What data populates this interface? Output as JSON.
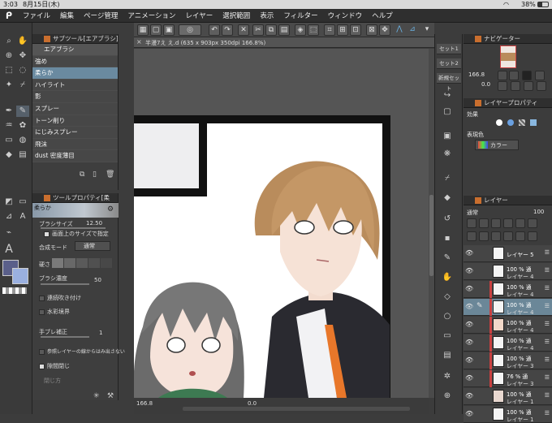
{
  "status_bar": {
    "time": "3:03",
    "date": "8月15日(木)",
    "battery": "38%"
  },
  "menu": {
    "items": [
      "ファイル",
      "編集",
      "ページ管理",
      "アニメーション",
      "レイヤー",
      "選択範囲",
      "表示",
      "フィルター",
      "ウィンドウ",
      "ヘルプ"
    ]
  },
  "document": {
    "tab_title": "半漫7え え.d (635 x 903px 350dpi 166.8%)"
  },
  "subtool": {
    "header": "サブツール[エアブラシ]",
    "group": "エアブラシ",
    "items": [
      "強め",
      "柔らか",
      "ハイライト",
      "影",
      "スプレー",
      "トーン削り",
      "にじみスプレー",
      "飛沫",
      "dust 密度薄目"
    ],
    "selected_index": 1
  },
  "tool_property": {
    "header": "ツールプロパティ[柔",
    "preview_label": "柔らか",
    "brush_size_label": "ブラシサイズ",
    "brush_size_value": "12.50",
    "canvas_size_label": "画面上のサイズで指定",
    "blend_label": "合成モード",
    "blend_value": "通常",
    "hardness_label": "硬さ",
    "density_label": "ブラシ濃度",
    "density_value": "50",
    "continuous_label": "連続吹き付け",
    "watercolor_label": "水彩境界",
    "stabilize_label": "手ブレ補正",
    "stabilize_value": "1",
    "reference_label": "参照レイヤーの線からはみ出さない",
    "gap_label": "隙間閉じ",
    "gap_method_label": "閉じ方"
  },
  "canvas_footer": {
    "zoom": "166.8",
    "zero": "0.0"
  },
  "right_strip": {
    "tabs": [
      "セット1",
      "セット2",
      "新規セット"
    ]
  },
  "navigator": {
    "header": "ナビゲーター",
    "zoom": "166.8",
    "rotation": "0.0"
  },
  "layer_property": {
    "header": "レイヤープロパティ",
    "effect_label": "効果",
    "expression_label": "表現色",
    "expression_value": "カラー"
  },
  "layers": {
    "header": "レイヤー",
    "blend": "通常",
    "opacity": "100",
    "rows": [
      {
        "line1": "レイヤー 5",
        "line2": ""
      },
      {
        "line1": "100 % 通",
        "line2": "レイヤー 4"
      },
      {
        "line1": "100 % 通",
        "line2": "レイヤー 4"
      },
      {
        "line1": "100 % 通",
        "line2": "レイヤー 4"
      },
      {
        "line1": "100 % 通",
        "line2": "レイヤー 4"
      },
      {
        "line1": "100 % 通",
        "line2": "レイヤー 4"
      },
      {
        "line1": "100 % 通",
        "line2": "レイヤー 3"
      },
      {
        "line1": "76 % 通",
        "line2": "レイヤー 3"
      },
      {
        "line1": "100 % 通",
        "line2": "レイヤー 1"
      },
      {
        "line1": "100 % 通",
        "line2": "レイヤー 1"
      }
    ],
    "selected_index": 3
  },
  "colors": {
    "accent": "#6a8aa0",
    "main_color": "#5a5f8a",
    "sub_color": "#9ab0e0"
  }
}
